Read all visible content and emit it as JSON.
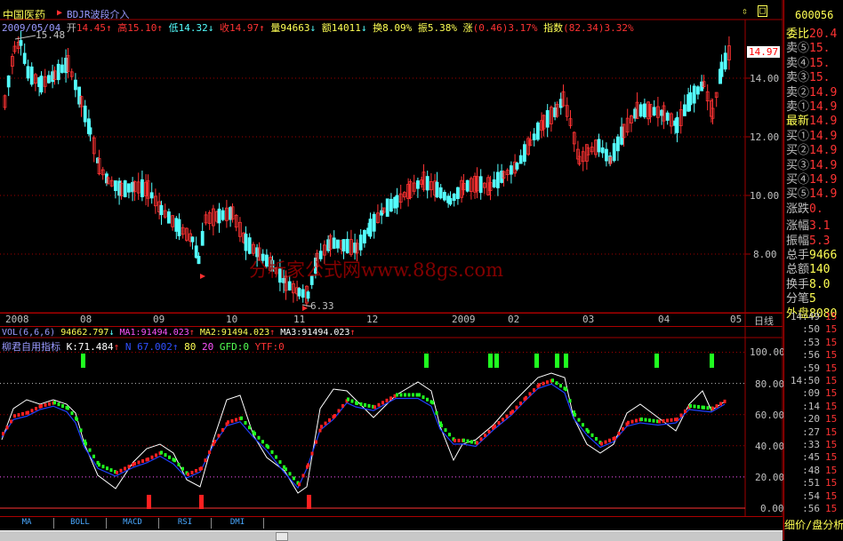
{
  "header": {
    "stock_name": "中国医药",
    "indicator_tag": "BDJR波段介入",
    "date": "2009/05/04",
    "open_label": "开",
    "open": "14.45",
    "high_label": "高",
    "high": "15.10",
    "low_label": "低",
    "low": "14.32",
    "close_label": "收",
    "close": "14.97",
    "vol_label": "量",
    "vol": "94663",
    "amount_label": "额",
    "amount": "14011",
    "turnover_label": "换",
    "turnover": "8.09%",
    "amp_label": "振",
    "amp": "5.38%",
    "chg_label": "涨",
    "chg": "(0.46)3.17%",
    "index_label": "指数",
    "index": "(82.34)3.32%",
    "max_marker": "15.48",
    "min_marker": "6.33",
    "last_price_tag": "14.97"
  },
  "price_axis": [
    "14.00",
    "12.00",
    "10.00",
    "8.00"
  ],
  "time_axis": [
    "2008",
    "08",
    "09",
    "10",
    "11",
    "12",
    "2009",
    "02",
    "03",
    "04",
    "05"
  ],
  "period_label": "日线",
  "watermark": "分析家公式网www.88gs.com",
  "vol_line": {
    "name": "VOL(6,6,6)",
    "v1": "94662.797",
    "ma1": "MA1:91494.023",
    "ma2": "MA2:91494.023",
    "ma3": "MA3:91494.023"
  },
  "indicator_line": {
    "name": "柳君自用指标",
    "k": "K:71.484",
    "n": "N 67.002",
    "v80": "80",
    "v20": "20",
    "gfd": "GFD:0",
    "ytf": "YTF:0"
  },
  "indicator_axis": [
    "100.00",
    "80.00",
    "60.00",
    "40.00",
    "20.00",
    "0.00"
  ],
  "tabs": [
    "MA",
    "BOLL",
    "MACD",
    "RSI",
    "DMI"
  ],
  "right_panel": {
    "code": "600056",
    "rows": [
      {
        "label": "委比",
        "value": "20.4"
      },
      {
        "label": "卖⑤",
        "value": "15."
      },
      {
        "label": "卖④",
        "value": "15."
      },
      {
        "label": "卖③",
        "value": "15."
      },
      {
        "label": "卖②",
        "value": "14.9"
      },
      {
        "label": "卖①",
        "value": "14.9"
      },
      {
        "label": "最新",
        "value": "14.9"
      },
      {
        "label": "买①",
        "value": "14.9"
      },
      {
        "label": "买②",
        "value": "14.9"
      },
      {
        "label": "买③",
        "value": "14.9"
      },
      {
        "label": "买④",
        "value": "14.9"
      },
      {
        "label": "买⑤",
        "value": "14.9"
      },
      {
        "label": "涨跌",
        "value": "0."
      },
      {
        "label": "涨幅",
        "value": "3.1"
      },
      {
        "label": "振幅",
        "value": "5.3"
      },
      {
        "label": "总手",
        "value": "9466"
      },
      {
        "label": "总额",
        "value": "140"
      },
      {
        "label": "换手",
        "value": "8.0"
      },
      {
        "label": "分笔",
        "value": "5"
      },
      {
        "label": "外盘",
        "value": "8080"
      }
    ],
    "ticks": [
      {
        "time": "14:49",
        "v": "15"
      },
      {
        "time": ":50",
        "v": "15"
      },
      {
        "time": ":53",
        "v": "15"
      },
      {
        "time": ":56",
        "v": "15"
      },
      {
        "time": ":59",
        "v": "15"
      },
      {
        "time": "14:50",
        "v": "15"
      },
      {
        "time": ":09",
        "v": "15"
      },
      {
        "time": ":14",
        "v": "15"
      },
      {
        "time": ":20",
        "v": "15"
      },
      {
        "time": ":27",
        "v": "15"
      },
      {
        "time": ":33",
        "v": "15"
      },
      {
        "time": ":45",
        "v": "15"
      },
      {
        "time": ":48",
        "v": "15"
      },
      {
        "time": ":51",
        "v": "15"
      },
      {
        "time": ":54",
        "v": "15"
      },
      {
        "time": ":56",
        "v": "15"
      }
    ],
    "footer": "细价/盘分析"
  },
  "colors": {
    "up": "#ff3333",
    "down": "#54ffff",
    "axis": "#a00000",
    "text_yellow": "#ffff54",
    "magenta": "#ff54ff"
  }
}
